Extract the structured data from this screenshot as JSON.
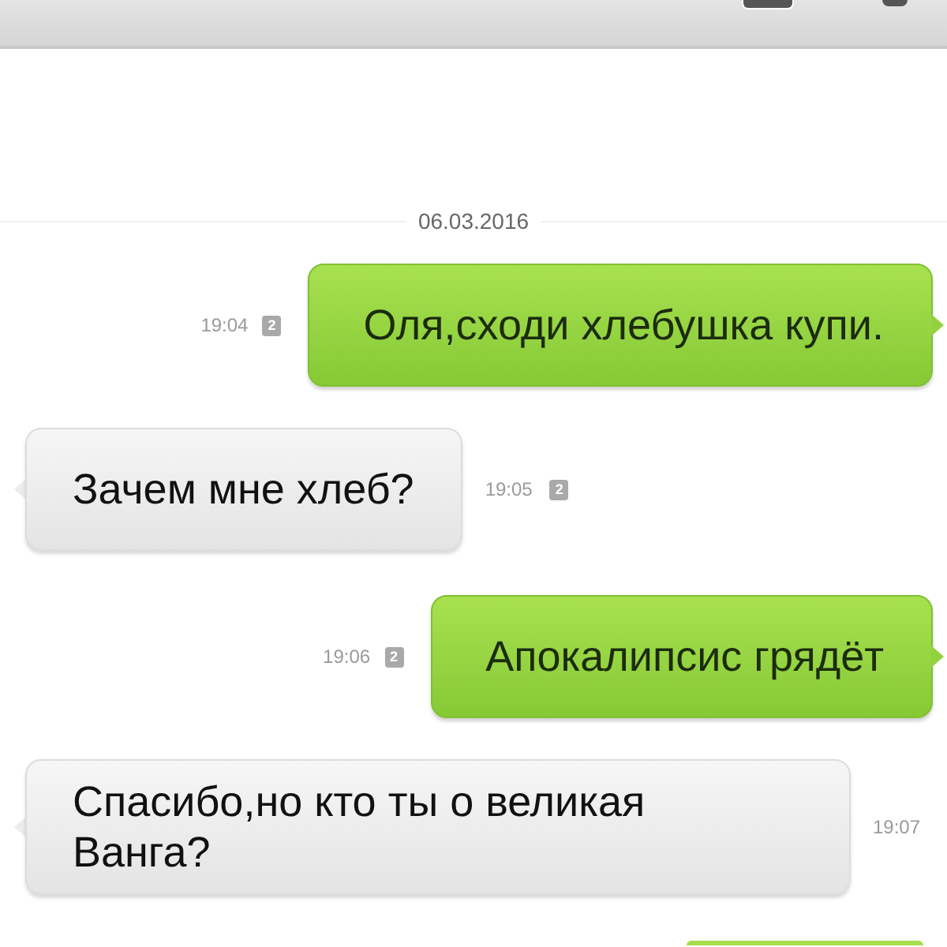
{
  "date_separator": "06.03.2016",
  "messages": [
    {
      "kind": "outgoing",
      "text": "Оля,сходи хлебушка купи.",
      "time": "19:04",
      "sim": "2"
    },
    {
      "kind": "incoming",
      "text": "Зачем мне хлеб?",
      "time": "19:05",
      "sim": "2"
    },
    {
      "kind": "outgoing",
      "text": "Апокалипсис грядёт",
      "time": "19:06",
      "sim": "2"
    },
    {
      "kind": "incoming",
      "text": "Спасибо,но кто ты о великая Ванга?",
      "time": "19:07"
    },
    {
      "kind": "outgoing"
    }
  ]
}
